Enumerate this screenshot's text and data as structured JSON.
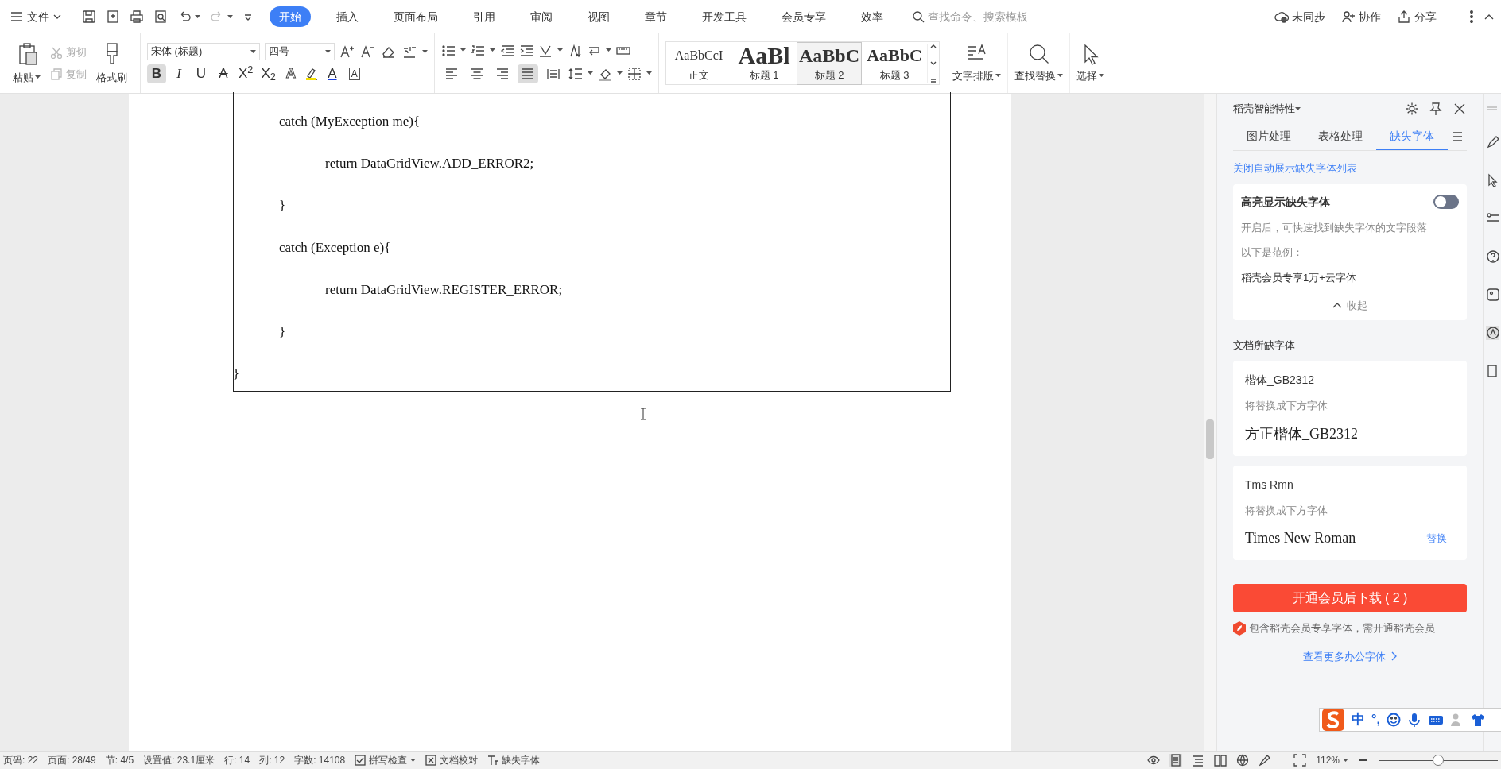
{
  "menu": {
    "file": "文件",
    "tabs": [
      {
        "label": "开始",
        "selected": true
      },
      {
        "label": "插入",
        "selected": false
      },
      {
        "label": "页面布局",
        "selected": false
      },
      {
        "label": "引用",
        "selected": false
      },
      {
        "label": "审阅",
        "selected": false
      },
      {
        "label": "视图",
        "selected": false
      },
      {
        "label": "章节",
        "selected": false
      },
      {
        "label": "开发工具",
        "selected": false
      },
      {
        "label": "会员专享",
        "selected": false
      },
      {
        "label": "效率",
        "selected": false
      }
    ],
    "search": {
      "placeholder": "查找命令、搜索模板"
    },
    "actions": [
      {
        "kind": "sync",
        "label": "未同步"
      },
      {
        "kind": "collab",
        "label": "协作"
      },
      {
        "kind": "share",
        "label": "分享"
      }
    ]
  },
  "ribbon": {
    "clipboard": {
      "paste": "粘贴",
      "cut": {
        "label": "剪切",
        "disabled": true
      },
      "copy": {
        "label": "复制",
        "disabled": true
      },
      "painter": "格式刷"
    },
    "font": {
      "name": "宋体 (标题)",
      "size": "四号",
      "format_buttons": [
        {
          "glyph": "B",
          "kind": "bold",
          "active": true
        },
        {
          "glyph": "I",
          "kind": "italic",
          "active": false
        },
        {
          "glyph": "U",
          "kind": "underline",
          "active": false
        },
        {
          "glyph": "A",
          "kind": "strike",
          "active": false
        },
        {
          "glyph": "X$^{2}$",
          "kind": "plain",
          "active": false
        },
        {
          "glyph": "X$_{2}$",
          "kind": "plain",
          "active": false
        },
        {
          "glyph": "A",
          "kind": "outline",
          "active": false
        },
        {
          "glyph": "A",
          "kind": "color",
          "active": false
        },
        {
          "glyph": "A",
          "kind": "boxed",
          "active": false
        }
      ]
    },
    "alignments": [
      {
        "kind": "left",
        "selected": false
      },
      {
        "kind": "center",
        "selected": false
      },
      {
        "kind": "right",
        "selected": false
      },
      {
        "kind": "justify",
        "selected": true
      },
      {
        "kind": "distributed",
        "selected": false
      }
    ],
    "styles": [
      {
        "preview": "AaBbCcI",
        "label": "正文",
        "kind": "normal",
        "selected": false
      },
      {
        "preview": "AaBl",
        "label": "标题 1",
        "kind": "h1",
        "selected": false
      },
      {
        "preview": "AaBbC",
        "label": "标题 2",
        "kind": "h2",
        "selected": true
      },
      {
        "preview": "AaBbC",
        "label": "标题 3",
        "kind": "h3",
        "selected": false
      }
    ],
    "tools": [
      {
        "kind": "layout",
        "label": "文字排版"
      },
      {
        "kind": "find",
        "label": "查找替换"
      },
      {
        "kind": "select",
        "label": "选择"
      }
    ]
  },
  "document": {
    "lines": [
      {
        "children": [
          {
            "text": "catch (MyException me){",
            "children": [
              {
                "text": "return DataGridView.ADD_ERROR2;"
              }
            ]
          },
          {
            "text": "}"
          },
          {
            "text": "catch (Exception e){",
            "children": [
              {
                "text": "return DataGridView.REGISTER_ERROR;"
              }
            ]
          },
          {
            "text": "}"
          }
        ]
      },
      {
        "text": "}"
      }
    ]
  },
  "panel": {
    "title": "稻壳智能特性",
    "tabs": [
      {
        "label": "图片处理",
        "selected": false
      },
      {
        "label": "表格处理",
        "selected": false
      },
      {
        "label": "缺失字体",
        "selected": true
      }
    ],
    "link": "关闭自动展示缺失字体列表",
    "highlight": {
      "title": "高亮显示缺失字体",
      "on": false,
      "description": "开启后，可快速找到缺失字体的文字段落",
      "example_label": "以下是范例：",
      "example": "稻壳会员专享1万+云字体",
      "collapse": "收起"
    },
    "section": "文档所缺字体",
    "fonts": [
      {
        "missing": "楷体_GB2312",
        "hint": "将替换成下方字体",
        "replacement": "方正楷体_GB2312"
      },
      {
        "missing": "Tms Rmn",
        "hint": "将替换成下方字体",
        "replacement": "Times New Roman",
        "action": "替换"
      }
    ],
    "download": "开通会员后下载 ( 2 )",
    "note": "包含稻壳会员专享字体，需开通稻壳会员",
    "more": "查看更多办公字体"
  },
  "ime": {
    "mode": "中",
    "punct": "°,"
  },
  "status": {
    "items": [
      {
        "kind": "text",
        "label": "页码: 22"
      },
      {
        "kind": "text",
        "label": "页面: 28/49"
      },
      {
        "kind": "text",
        "label": "节: 4/5"
      },
      {
        "kind": "text",
        "label": "设置值: 23.1厘米"
      },
      {
        "kind": "text",
        "label": "行: 14"
      },
      {
        "kind": "text",
        "label": "列: 12"
      },
      {
        "kind": "text",
        "label": "字数: 14108"
      },
      {
        "kind": "check",
        "label": "拼写检查"
      },
      {
        "kind": "proof",
        "label": "文档校对"
      },
      {
        "kind": "font",
        "label": "缺失字体"
      }
    ],
    "zoom": "112%",
    "zoom_level": {
      "level": 0.5
    }
  }
}
